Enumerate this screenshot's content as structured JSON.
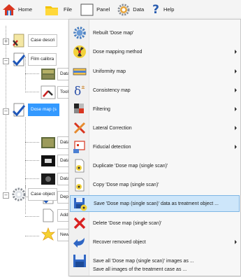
{
  "toolbar": {
    "items": [
      {
        "label": "Home",
        "icon": "home-icon"
      },
      {
        "label": "File",
        "icon": "folder-icon"
      },
      {
        "label": "Panel",
        "icon": "panel-icon"
      },
      {
        "label": "Data",
        "icon": "data-gear-icon"
      },
      {
        "label": "Help",
        "icon": "help-icon"
      }
    ]
  },
  "tree": {
    "nodes": [
      {
        "label": "Case descri",
        "icon": "case-check-icon"
      },
      {
        "label": "Film calibra",
        "icon": "calibration-check-icon"
      },
      {
        "label": "Data",
        "icon": "film-strip-icon"
      },
      {
        "label": "Tool",
        "icon": "tool-icon"
      },
      {
        "label": "Dose map (s",
        "icon": "dose-check-icon",
        "selected": true
      },
      {
        "label": "Data",
        "icon": "film-image-icon"
      },
      {
        "label": "Data",
        "icon": "film-dark-icon"
      },
      {
        "label": "Data",
        "icon": "film-scan-icon"
      },
      {
        "label": "Depe",
        "icon": "dependent-doc-icon"
      },
      {
        "label": "Case object",
        "icon": "case-object-gear-icon"
      },
      {
        "label": "Add n",
        "icon": "add-doc-icon"
      },
      {
        "label": "New",
        "icon": "new-star-icon"
      }
    ]
  },
  "menu": {
    "items": [
      {
        "label": "Rebuilt 'Dose map'",
        "icon": "rebuild-gear-icon",
        "submenu": false
      },
      {
        "label": "Dose mapping method",
        "icon": "radiation-icon",
        "submenu": true
      },
      {
        "label": "Uniformity map",
        "icon": "uniformity-icon",
        "submenu": true
      },
      {
        "label": "Consistency map",
        "icon": "delta-icon",
        "submenu": true
      },
      {
        "label": "Filtering",
        "icon": "filter-icon",
        "submenu": true
      },
      {
        "label": "Lateral Correction",
        "icon": "lateral-correction-icon",
        "submenu": true
      },
      {
        "label": "Fiducial detection",
        "icon": "fiducial-icon",
        "submenu": true
      },
      {
        "label": "Duplicate 'Dose map (single scan)'",
        "icon": "duplicate-icon",
        "submenu": false
      },
      {
        "label": "Copy 'Dose map (single scan)'",
        "icon": "copy-icon",
        "submenu": false
      },
      {
        "label": "Save 'Dose map (single scan)' data as treatment object ...",
        "icon": "save-treatment-icon",
        "submenu": false,
        "highlighted": true
      },
      {
        "label": "Delete 'Dose map (single scan)'",
        "icon": "delete-x-icon",
        "submenu": false
      },
      {
        "label": "Recover removed object",
        "icon": "recover-arrow-icon",
        "submenu": true
      },
      {
        "label": "Save all 'Dose map (single scan)' images as ...",
        "icon": "save-disk-icon",
        "submenu": false
      },
      {
        "label": "Save all images of the treatment case as ...",
        "icon": "blank-icon",
        "submenu": false
      }
    ]
  },
  "colors": {
    "selection": "#3399ff",
    "menu_highlight": "#cde6fa",
    "menu_highlight_border": "#7fb6e4"
  }
}
